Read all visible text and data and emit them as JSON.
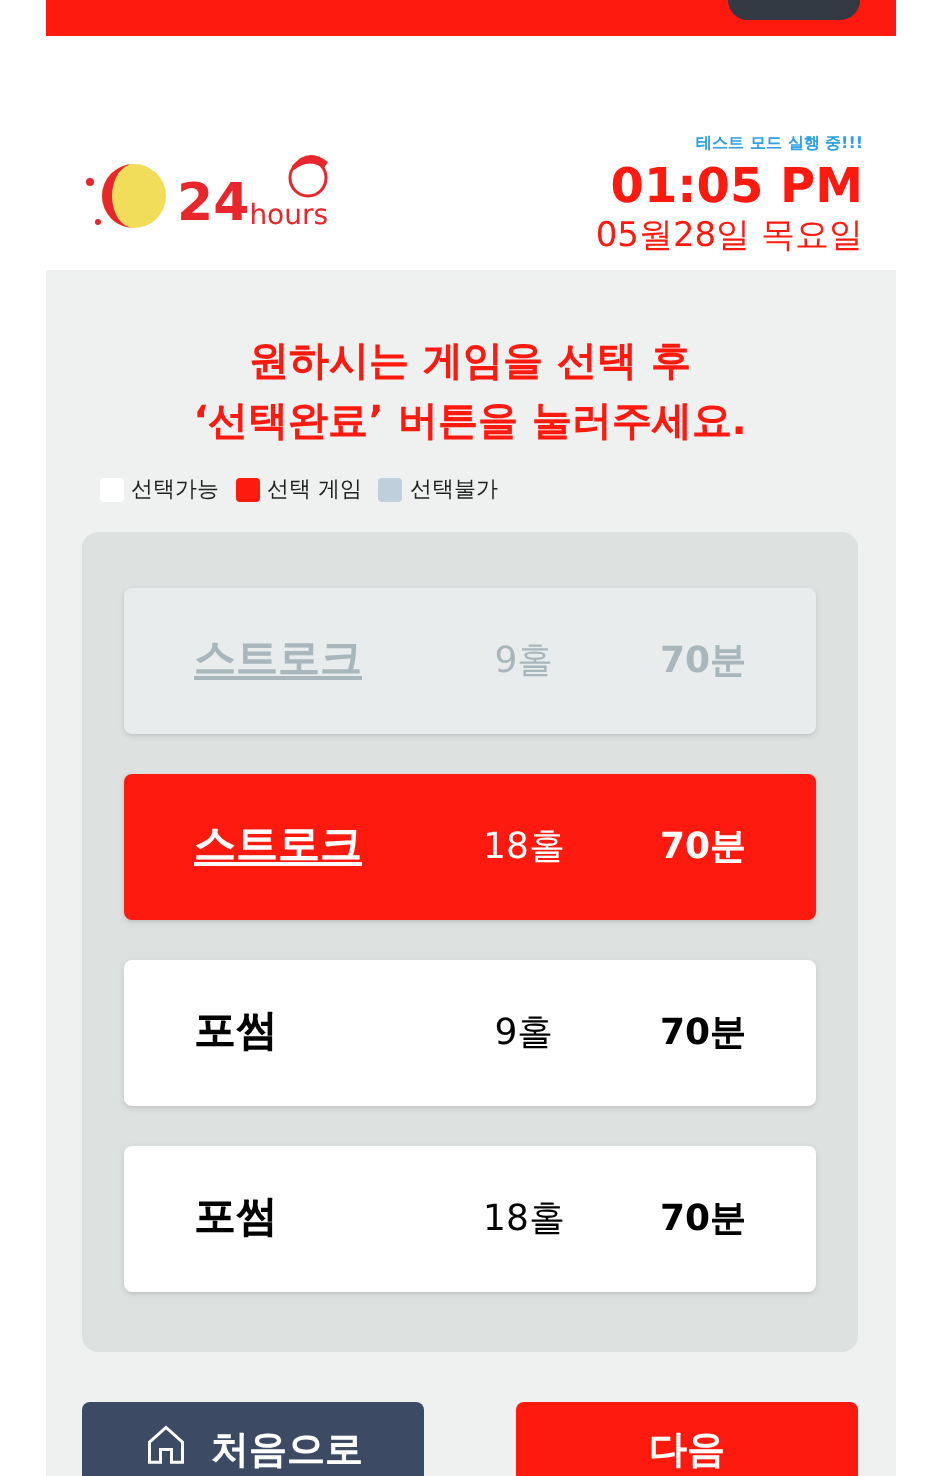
{
  "logo": {
    "number": "24",
    "word": "hours"
  },
  "header": {
    "notice": "테스트 모드 실행 중!!!",
    "time": "01:05 PM",
    "date": "05월28일 목요일"
  },
  "instruction": {
    "line_1": "원하시는 게임을 선택 후",
    "line_2": "‘선택완료’ 버튼을 눌러주세요."
  },
  "legend": [
    {
      "label": "선택가능",
      "color": "#ffffff"
    },
    {
      "label": "선택 게임",
      "color": "#ff1a0f"
    },
    {
      "label": "선택불가",
      "color": "#bfd0dc"
    }
  ],
  "games": [
    {
      "name": "스트로크",
      "holes": "9홀",
      "time": "70분",
      "selected": false,
      "disabled": true
    },
    {
      "name": "스트로크",
      "holes": "18홀",
      "time": "70분",
      "selected": true,
      "disabled": false
    },
    {
      "name": "포썸",
      "holes": "9홀",
      "time": "70분",
      "selected": false,
      "disabled": false
    },
    {
      "name": "포썸",
      "holes": "18홀",
      "time": "70분",
      "selected": false,
      "disabled": false
    }
  ],
  "buttons": {
    "home": "처음으로",
    "next": "다음"
  }
}
